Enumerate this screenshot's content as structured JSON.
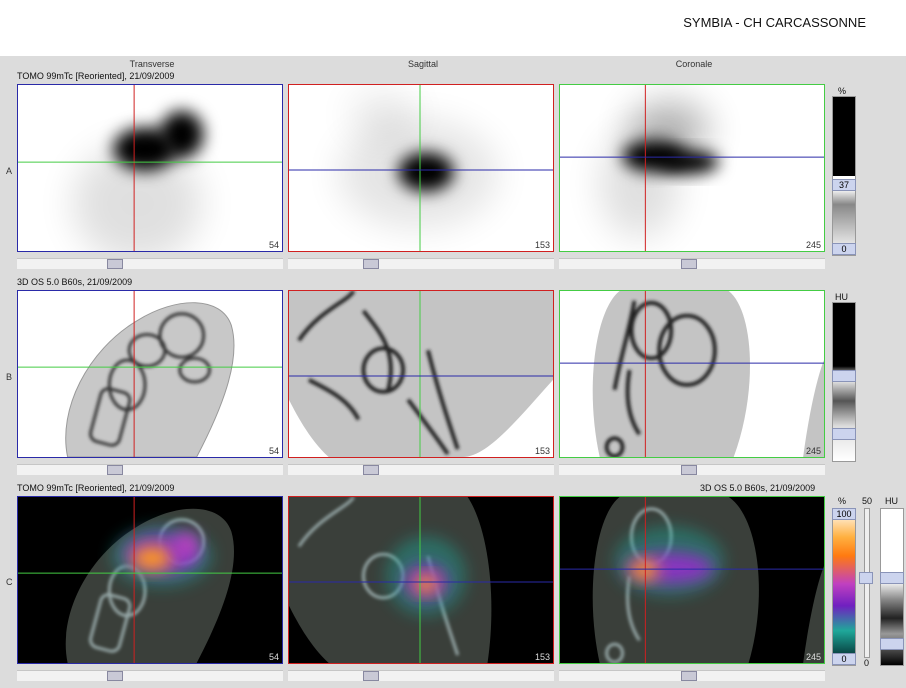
{
  "header": {
    "brand": "SYMBIA - CH CARCASSONNE"
  },
  "columns": [
    "Transverse",
    "Sagittal",
    "Coronale"
  ],
  "rows": [
    {
      "label": "A",
      "info": "TOMO 99mTc [Reoriented], 21/09/2009",
      "info_right": "",
      "slices": [
        "54",
        "153",
        "245"
      ]
    },
    {
      "label": "B",
      "info": "3D  OS  5.0  B60s, 21/09/2009",
      "info_right": "",
      "slices": [
        "54",
        "153",
        "245"
      ]
    },
    {
      "label": "C",
      "info": "TOMO 99mTc [Reoriented], 21/09/2009",
      "info_right": "3D  OS  5.0  B60s, 21/09/2009",
      "slices": [
        "54",
        "153",
        "245"
      ]
    }
  ],
  "scales": {
    "a": {
      "unit": "%",
      "upper": "37",
      "lower": "0"
    },
    "b": {
      "unit": "HU"
    },
    "c": {
      "unit_pct": "%",
      "top_pct": "100",
      "bottom_pct": "0",
      "mid_value": "50",
      "mid_bottom": "0",
      "unit_hu": "HU"
    }
  },
  "colors": {
    "red": "#d02020",
    "green": "#44cc44",
    "blue": "#2a2aa8",
    "background": "#dcdcdc"
  }
}
